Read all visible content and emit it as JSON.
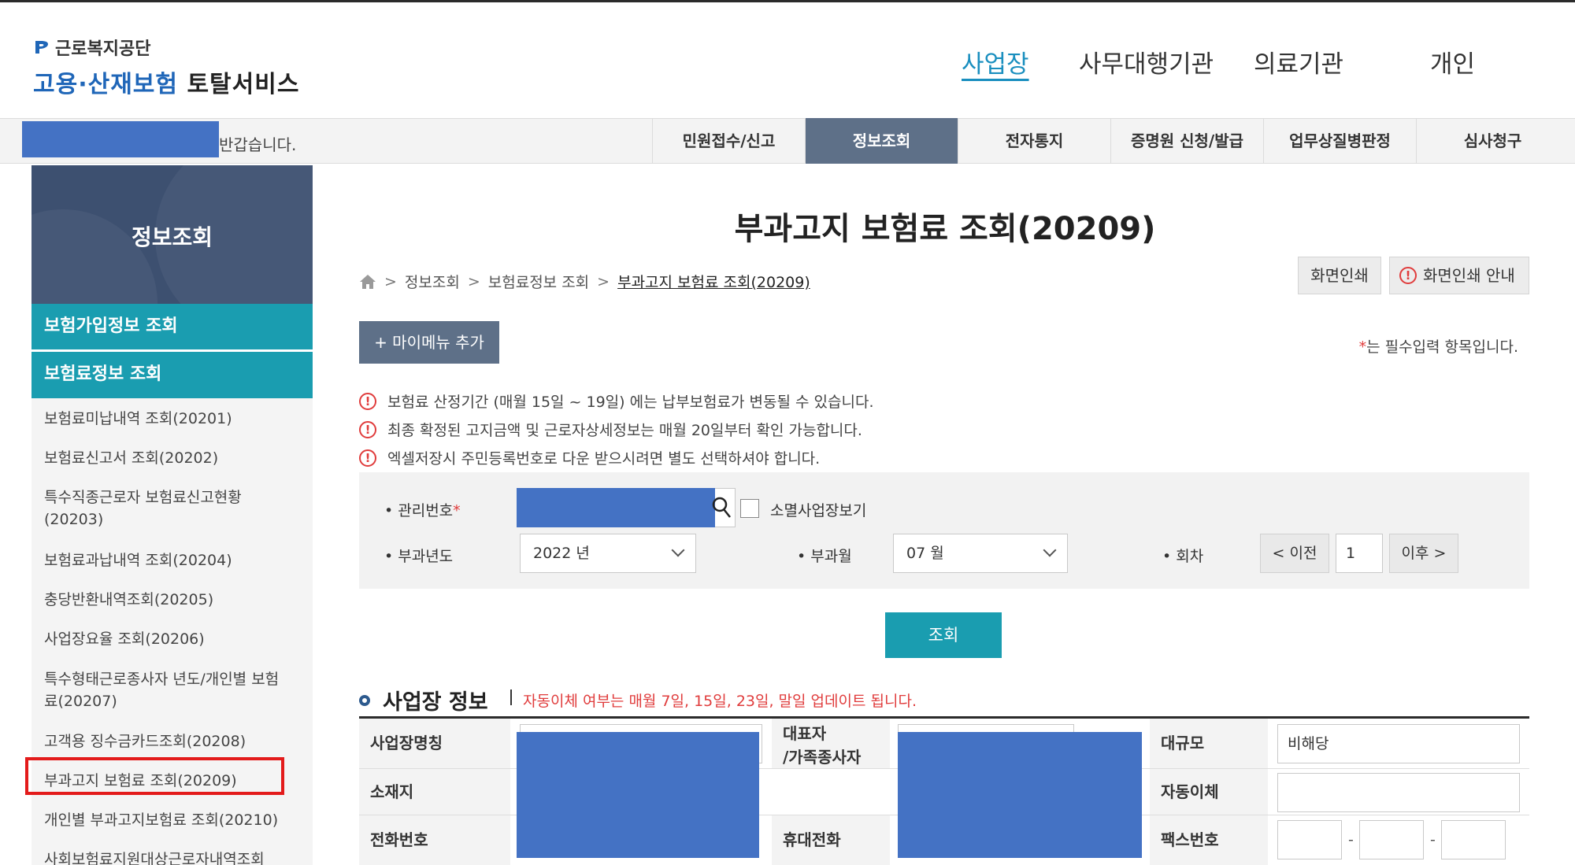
{
  "header": {
    "org_name": "근로복지공단",
    "service_name_blue": "고용·산재보험",
    "service_name_dark": "토탈서비스",
    "top_nav": [
      "사업장",
      "사무대행기관",
      "의료기관",
      "개인"
    ]
  },
  "gnb": {
    "welcome_suffix": "반갑습니다.",
    "menu": [
      "민원접수/신고",
      "정보조회",
      "전자통지",
      "증명원 신청/발급",
      "업무상질병판정",
      "심사청구"
    ]
  },
  "sidebar": {
    "title": "정보조회",
    "categories": [
      "보험가입정보 조회",
      "보험료정보 조회"
    ],
    "items": [
      "보험료미납내역 조회(20201)",
      "보험료신고서 조회(20202)",
      "특수직종근로자 보험료신고현황(20203)",
      "보험료과납내역 조회(20204)",
      "충당반환내역조회(20205)",
      "사업장요율 조회(20206)",
      "특수형태근로종사자 년도/개인별 보험료(20207)",
      "고객용 징수금카드조회(20208)",
      "부과고지 보험료 조회(20209)",
      "개인별 부과고지보험료 조회(20210)",
      "사회보험료지원대상근로자내역조회"
    ]
  },
  "main": {
    "title": "부과고지 보험료 조회(20209)",
    "breadcrumb": [
      "정보조회",
      "보험료정보 조회",
      "부과고지 보험료 조회(20209)"
    ],
    "print_button": "화면인쇄",
    "print_guide_button": "화면인쇄 안내",
    "mymenu_button": "+ 마이메뉴 추가",
    "required_note_star": "*",
    "required_note": "는 필수입력 항목입니다.",
    "notices": [
      "보험료 산정기간 (매월 15일 ~ 19일) 에는 납부보험료가 변동될 수 있습니다.",
      "최종 확정된 고지금액 및 근로자상세정보는 매월 20일부터 확인 가능합니다.",
      "엑셀저장시 주민등록번호로 다운 받으시려면 별도 선택하셔야 합니다."
    ],
    "form": {
      "mgmt_label": "• 관리번호",
      "closed_label": "소멸사업장보기",
      "year_label": "• 부과년도",
      "year_value": "2022 년",
      "month_label": "• 부과월",
      "month_value": "07 월",
      "round_label": "• 회차",
      "prev_button": "< 이전",
      "round_value": "1",
      "next_button": "이후 >",
      "search_button": "조회"
    },
    "section": {
      "title": "사업장 정보",
      "note": "자동이체 여부는 매월 7일, 15일, 23일, 말일 업데이트 됩니다.",
      "headers": {
        "name": "사업장명칭",
        "rep_1": "대표자",
        "rep_2": "/가족종사자",
        "size": "대규모",
        "address": "소재지",
        "auto_transfer": "자동이체",
        "phone": "전화번호",
        "mobile": "휴대전화",
        "fax": "팩스번호"
      },
      "size_value": "비해당"
    }
  }
}
